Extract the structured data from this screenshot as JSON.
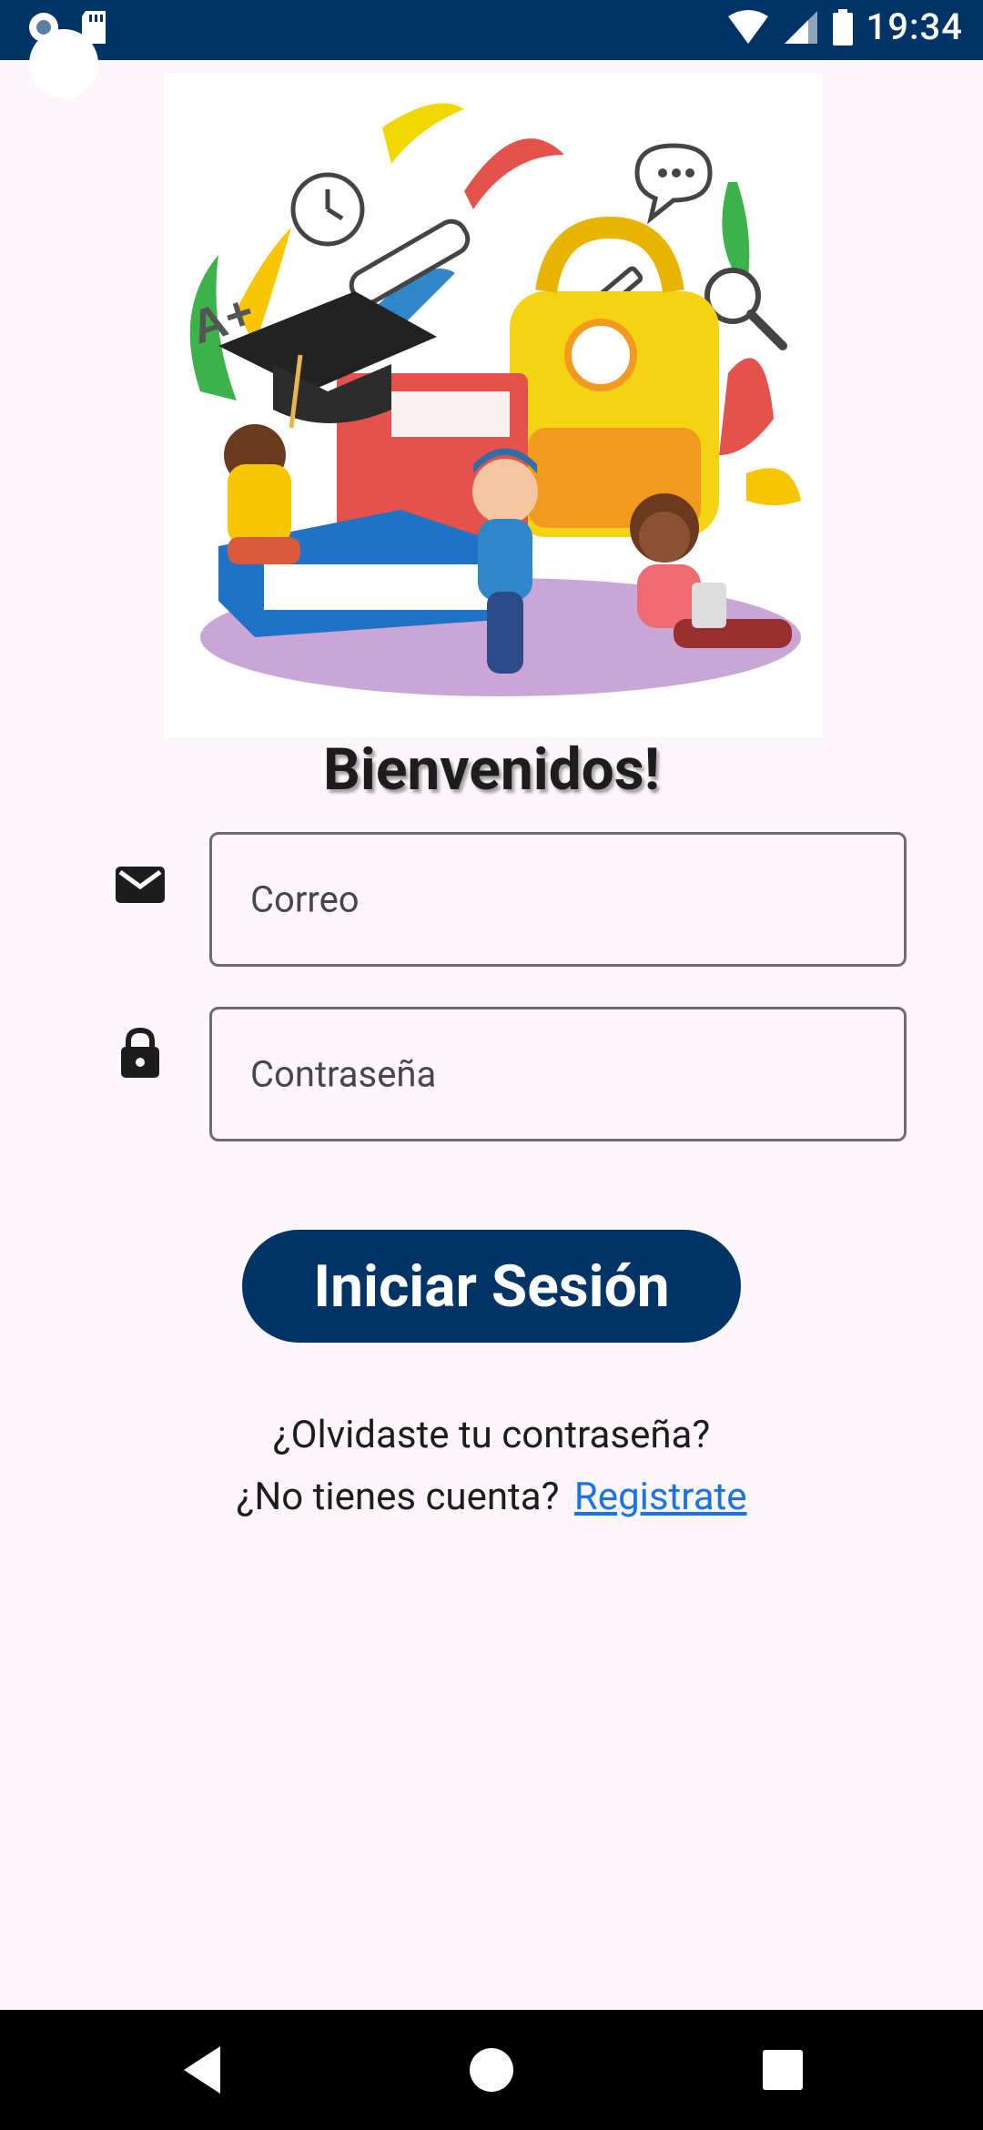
{
  "status_bar": {
    "time": "19:34"
  },
  "login": {
    "welcome": "Bienvenidos!",
    "email_placeholder": "Correo",
    "password_placeholder": "Contraseña",
    "login_button": "Iniciar Sesión",
    "forgot_password": "¿Olvidaste tu contraseña?",
    "no_account": "¿No tienes cuenta?",
    "register_link": "Registrate"
  },
  "icons": {
    "email": "mail-icon",
    "password": "lock-icon"
  },
  "colors": {
    "primary": "#003366",
    "link": "#1a73e8",
    "background": "#fdf7fb"
  }
}
